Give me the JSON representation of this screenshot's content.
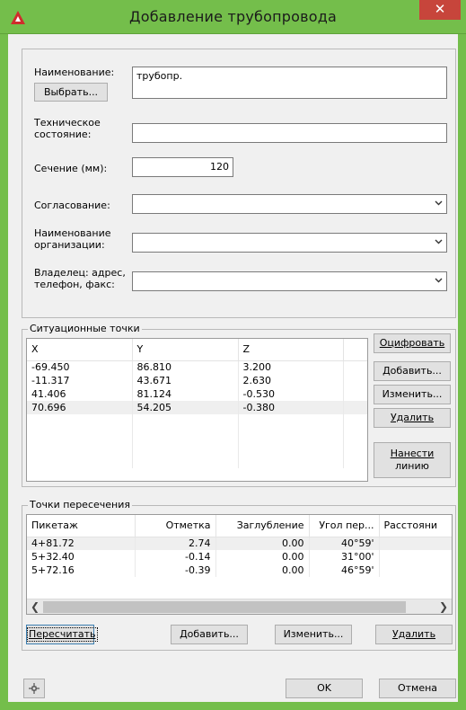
{
  "window": {
    "title": "Добавление трубопровода",
    "close_glyph": "✕"
  },
  "form": {
    "name_label": "Наименование:",
    "name_value": "трубопр.",
    "choose_button": "Выбрать...",
    "tech_state_label_1": "Техническое",
    "tech_state_label_2": "состояние:",
    "tech_state_value": "",
    "section_label": "Сечение (мм):",
    "section_value": "120",
    "approval_label": "Согласование:",
    "approval_value": "",
    "org_label_1": "Наименование",
    "org_label_2": "организации:",
    "org_value": "",
    "owner_label_1": "Владелец: адрес,",
    "owner_label_2": "телефон, факс:",
    "owner_value": ""
  },
  "situational_points": {
    "legend": "Ситуационные точки",
    "columns": [
      "X",
      "Y",
      "Z"
    ],
    "rows": [
      [
        "-69.450",
        "86.810",
        "3.200"
      ],
      [
        "-11.317",
        "43.671",
        "2.630"
      ],
      [
        "41.406",
        "81.124",
        "-0.530"
      ],
      [
        "70.696",
        "54.205",
        "-0.380"
      ]
    ],
    "buttons": {
      "digitize": "Оцифровать",
      "add": "Добавить...",
      "edit": "Изменить...",
      "delete": "Удалить",
      "draw_line_1": "Нанести",
      "draw_line_2": "линию"
    }
  },
  "intersection_points": {
    "legend": "Точки пересечения",
    "columns": [
      "Пикетаж",
      "Отметка",
      "Заглубление",
      "Угол пер...",
      "Расстояни"
    ],
    "rows": [
      [
        "4+81.72",
        "2.74",
        "0.00",
        "40°59'",
        ""
      ],
      [
        "5+32.40",
        "-0.14",
        "0.00",
        "31°00'",
        ""
      ],
      [
        "5+72.16",
        "-0.39",
        "0.00",
        "46°59'",
        ""
      ]
    ],
    "buttons": {
      "recalc": "Пересчитать",
      "add": "Добавить...",
      "edit": "Изменить...",
      "delete": "Удалить"
    }
  },
  "footer": {
    "ok": "OK",
    "cancel": "Отмена"
  },
  "colors": {
    "titlebar": "#74be4b",
    "close": "#c7453b",
    "app_icon": "#d02c2c"
  }
}
